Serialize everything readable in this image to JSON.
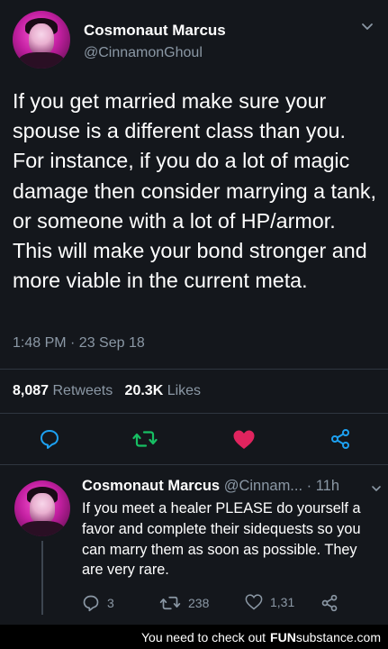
{
  "tweet": {
    "author_name": "Cosmonaut Marcus",
    "author_handle": "@CinnamonGhoul",
    "text": "If you get married make sure your spouse is a different class than you. For instance, if you do a lot of magic damage then consider marrying a tank, or someone with a lot of HP/armor. This will make your bond stronger and more viable in the current meta.",
    "timestamp": "1:48 PM · 23 Sep 18",
    "retweets_count": "8,087",
    "retweets_label": "Retweets",
    "likes_count": "20.3K",
    "likes_label": "Likes"
  },
  "reply": {
    "author_name": "Cosmonaut Marcus",
    "author_handle": "@Cinnam...",
    "time": "· 11h",
    "text": "If you meet a healer PLEASE do yourself a favor and complete their sidequests so you can marry them as soon as possible. They are very rare.",
    "reply_count": "3",
    "retweet_count": "238",
    "like_count": "1,31"
  },
  "footer": {
    "text": "You need to check out",
    "brand_fun": "FUN",
    "brand_substance": "substance",
    "brand_com": ".com"
  },
  "icons": {
    "reply": "reply-icon",
    "retweet": "retweet-icon",
    "like": "heart-icon",
    "share": "share-icon",
    "caret": "chevron-down-icon"
  },
  "colors": {
    "background": "#14171c",
    "secondary_text": "#8b98a5",
    "retweet_green": "#17bf63",
    "like_pink": "#e0245e",
    "reply_blue": "#1da1f2"
  }
}
